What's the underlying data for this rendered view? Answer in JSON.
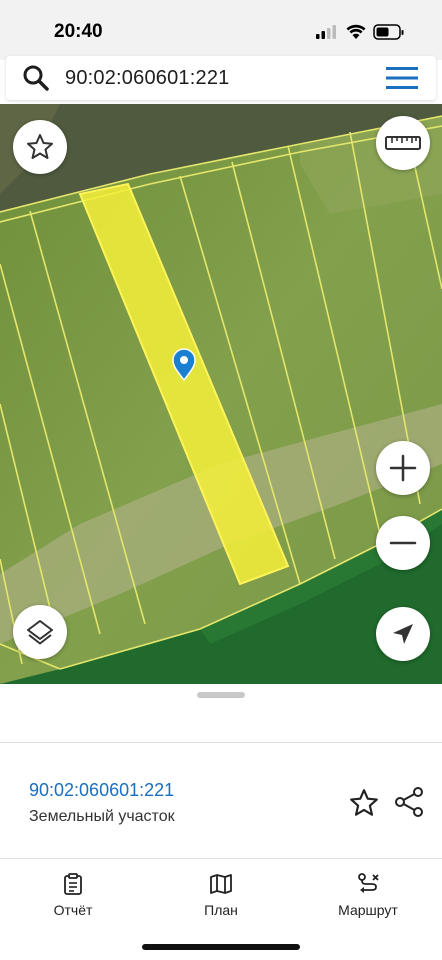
{
  "status_bar": {
    "time": "20:40"
  },
  "search": {
    "value": "90:02:060601:221"
  },
  "map": {
    "icons": [
      "star-icon",
      "ruler-icon",
      "plus-icon",
      "minus-icon",
      "layers-icon",
      "navigation-arrow-icon",
      "map-pin-icon"
    ],
    "colors": {
      "selected_parcel": "#f4f03a",
      "parcel_border": "#e8e86a",
      "field": "#7c9b46",
      "forest": "#1f6a2c"
    }
  },
  "sheet": {
    "parcel_number": "90:02:060601:221",
    "parcel_type": "Земельный участок"
  },
  "tabs": [
    {
      "label": "Отчёт",
      "icon": "report-icon"
    },
    {
      "label": "План",
      "icon": "map-icon"
    },
    {
      "label": "Маршрут",
      "icon": "route-icon"
    }
  ]
}
